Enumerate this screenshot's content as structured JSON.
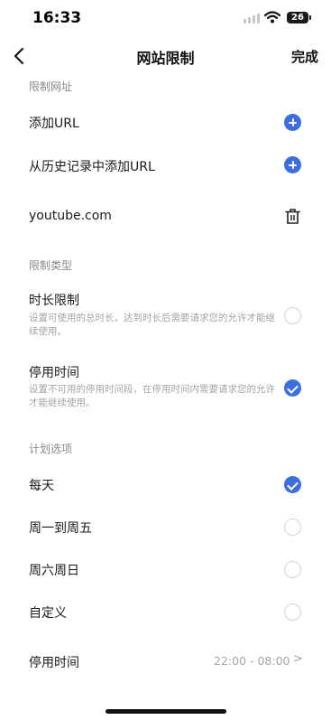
{
  "status_bar": {
    "time": "16:33",
    "battery": "26"
  },
  "nav": {
    "title": "网站限制",
    "done": "完成"
  },
  "restricted_urls": {
    "header": "限制网址",
    "add_url": "添加URL",
    "add_from_history": "从历史记录中添加URL",
    "entries": [
      "youtube.com"
    ]
  },
  "restriction_type": {
    "header": "限制类型",
    "options": [
      {
        "title": "时长限制",
        "description": "设置可使用的总时长，达到时长后需要请求您的允许才能继续使用。",
        "selected": false
      },
      {
        "title": "停用时间",
        "description": "设置不可用的停用时间段，在停用时间内需要请求您的允许才能继续使用。",
        "selected": true
      }
    ]
  },
  "schedule": {
    "header": "计划选项",
    "options": [
      {
        "label": "每天",
        "selected": true
      },
      {
        "label": "周一到周五",
        "selected": false
      },
      {
        "label": "周六周日",
        "selected": false
      },
      {
        "label": "自定义",
        "selected": false
      }
    ],
    "downtime_label": "停用时间",
    "downtime_value": "22:00 - 08:00",
    "chevron": ">"
  },
  "colors": {
    "accent": "#3d6ee0",
    "secondary_text": "#a4a4a4",
    "section_header": "#8a8a8a"
  },
  "icons": {
    "back": "chevron-left-icon",
    "add": "plus-circle-icon",
    "delete": "trash-icon",
    "selected": "check-circle-icon",
    "unselected": "empty-circle-icon",
    "wifi": "wifi-icon",
    "battery": "battery-icon",
    "signal": "cellular-signal-icon"
  }
}
